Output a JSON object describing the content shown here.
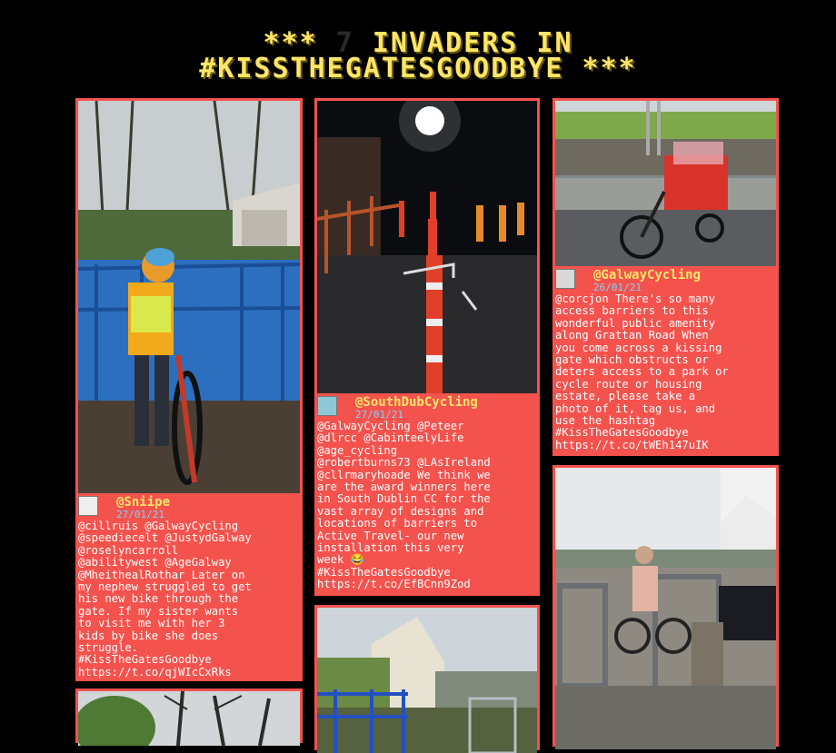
{
  "page": {
    "title_prefix": "*** ",
    "title_count": "7",
    "title_rest": " INVADERS IN",
    "title_line2": "#KISSTHEGATESGOODBYE ***"
  },
  "posts": [
    {
      "photo_icon": "photo-child-with-bike-at-blue-gate",
      "user": "@Sniipe",
      "date": "27/01/21",
      "lines": [
        "@cillruis @GalwayCycling",
        "@speediecelt @JustydGalway",
        "@roselyncarroll",
        "@abilitywest @AgeGalway",
        "@MheithealRothar Later on",
        "my nephew struggled to get",
        "his new bike through the",
        "gate. If my sister wants",
        "to visit me with her 3",
        "kids by bike she does",
        "struggle.",
        "#KissTheGatesGoodbye",
        "https://t.co/qjWIcCxRks"
      ]
    },
    {
      "photo_icon": "photo-night-bollards-cycle-lane",
      "user": "@SouthDubCycling",
      "date": "27/01/21",
      "lines": [
        "@GalwayCycling @Peteer",
        "@dlrcc @CabinteelyLife",
        "@age_cycling",
        "@robertburns73 @LAsIreland",
        "@cllrmaryhoade We think we",
        "are the award winners here",
        "in South Dublin CC for the",
        "vast array of designs and",
        "locations of barriers to",
        "Active Travel- our new",
        "installation this very",
        "week 😂",
        "#KissTheGatesGoodbye",
        "https://t.co/EfBCnn9Zod"
      ]
    },
    {
      "photo_icon": "photo-cargo-bike-at-gate",
      "user": "@GalwayCycling",
      "date": "26/01/21",
      "lines": [
        "@corcjon There's so many",
        "access barriers to this",
        "wonderful public amenity",
        "along Grattan Road When",
        "you come across a kissing",
        "gate which obstructs or",
        "deters access to a park or",
        "cycle route or housing",
        "estate, please take a",
        "photo of it, tag us, and",
        "use the hashtag",
        "#KissTheGatesGoodbye",
        "https://t.co/tWEh147uIK"
      ]
    },
    {
      "photo_icon": "photo-bare-trees"
    },
    {
      "photo_icon": "photo-blue-gate-lane"
    },
    {
      "photo_icon": "photo-woman-with-bike-at-kissing-gate"
    }
  ]
}
